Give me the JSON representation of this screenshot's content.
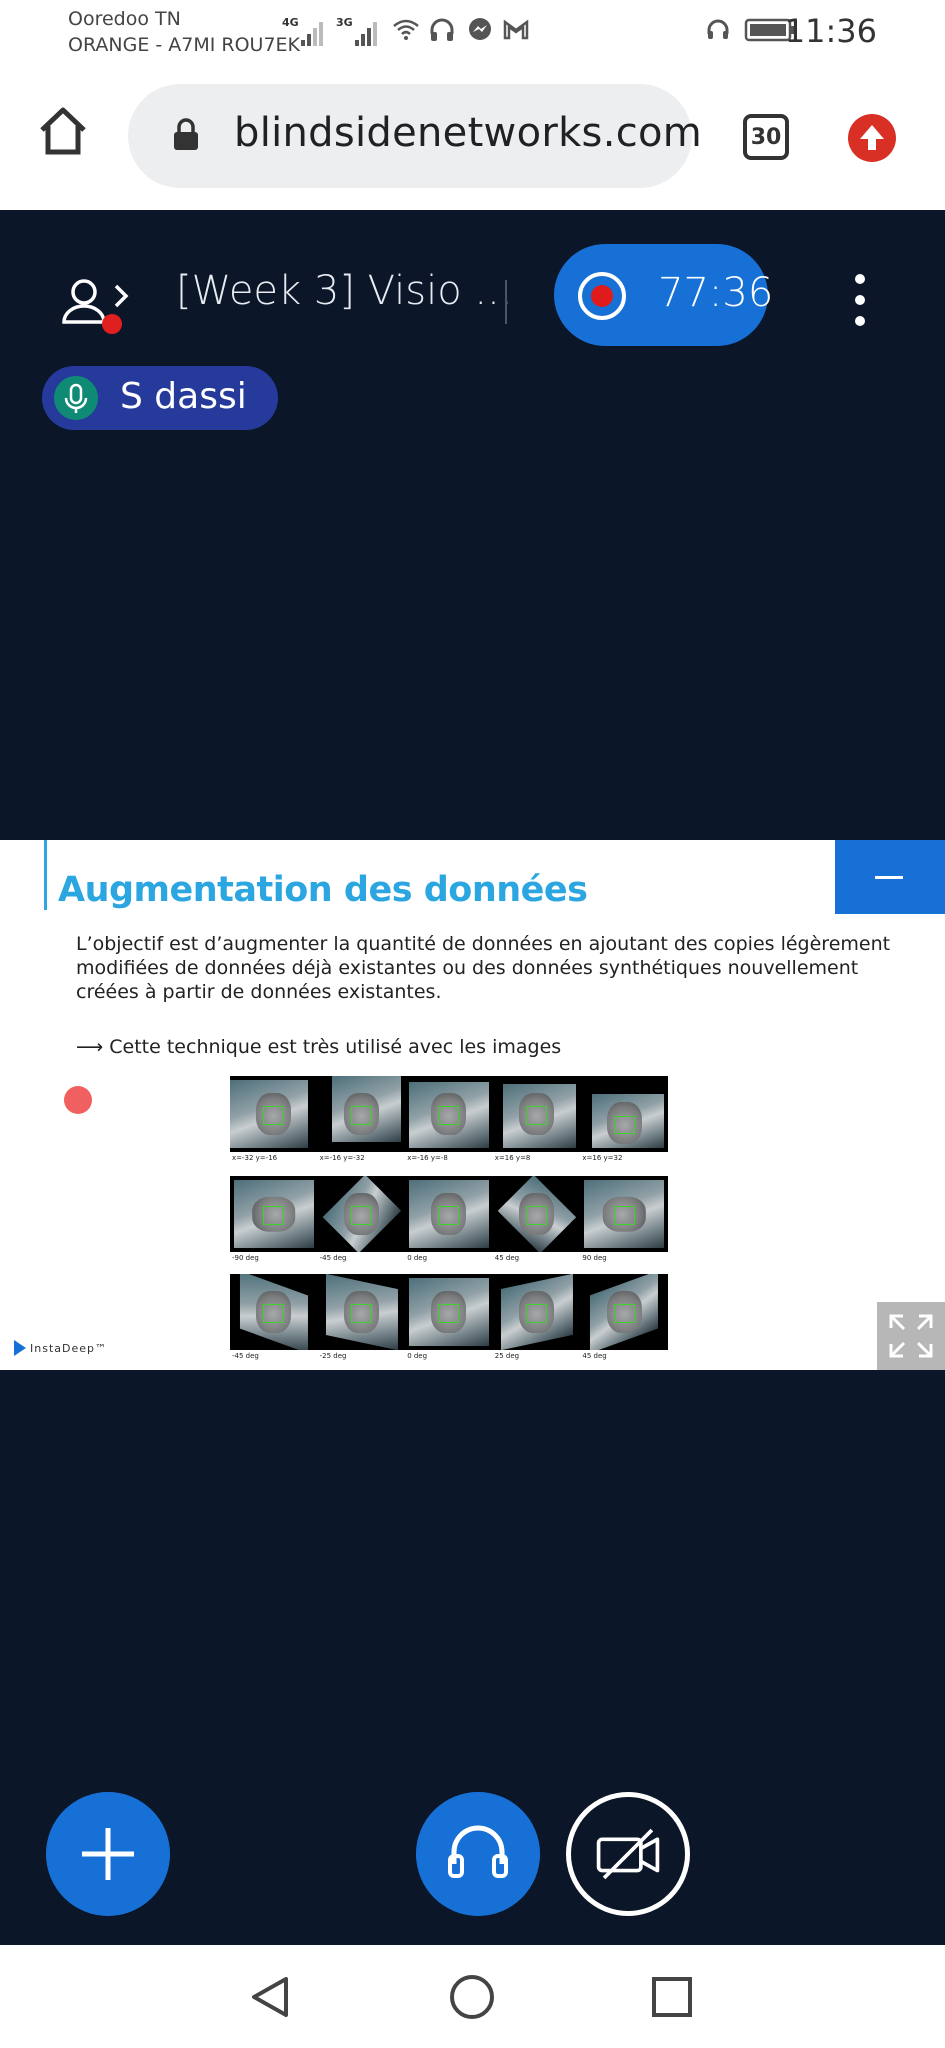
{
  "status": {
    "carrier_line1": "Ooredoo TN",
    "carrier_line2": "ORANGE - A7MI ROU7EK",
    "net1": "4G",
    "net2": "3G",
    "time": "11:36",
    "icons": [
      "wifi-icon",
      "headphones-icon",
      "messenger-icon",
      "gmail-icon",
      "headset-icon",
      "battery-icon"
    ]
  },
  "browser": {
    "url": "blindsidenetworks.com",
    "tab_count": "30"
  },
  "meeting": {
    "title": "[Week 3] Visio ...",
    "record_time": "77:36",
    "talker": "S dassi"
  },
  "slide": {
    "title": "Augmentation des données",
    "body": "L’objectif est d’augmenter la quantité de données en ajoutant des copies légèrement modifiées de données déjà existantes ou des données synthétiques nouvellement créées à partir de données existantes.",
    "bullet": "⟶ Cette technique est très utilisé avec les images",
    "logo": "InstaDeep™",
    "row1_labels": [
      "x=-32 y=-16",
      "x=-16 y=-32",
      "x=-16 y=-8",
      "x=16 y=8",
      "x=16 y=32"
    ],
    "row2_labels": [
      "-90 deg",
      "-45 deg",
      "0 deg",
      "45 deg",
      "90 deg"
    ],
    "row3_labels": [
      "-45 deg",
      "-25 deg",
      "0 deg",
      "25 deg",
      "45 deg"
    ]
  },
  "colors": {
    "accent": "#1670d6",
    "background": "#0b1628",
    "slide_title": "#2ca6e0",
    "record": "#e01b1b"
  }
}
